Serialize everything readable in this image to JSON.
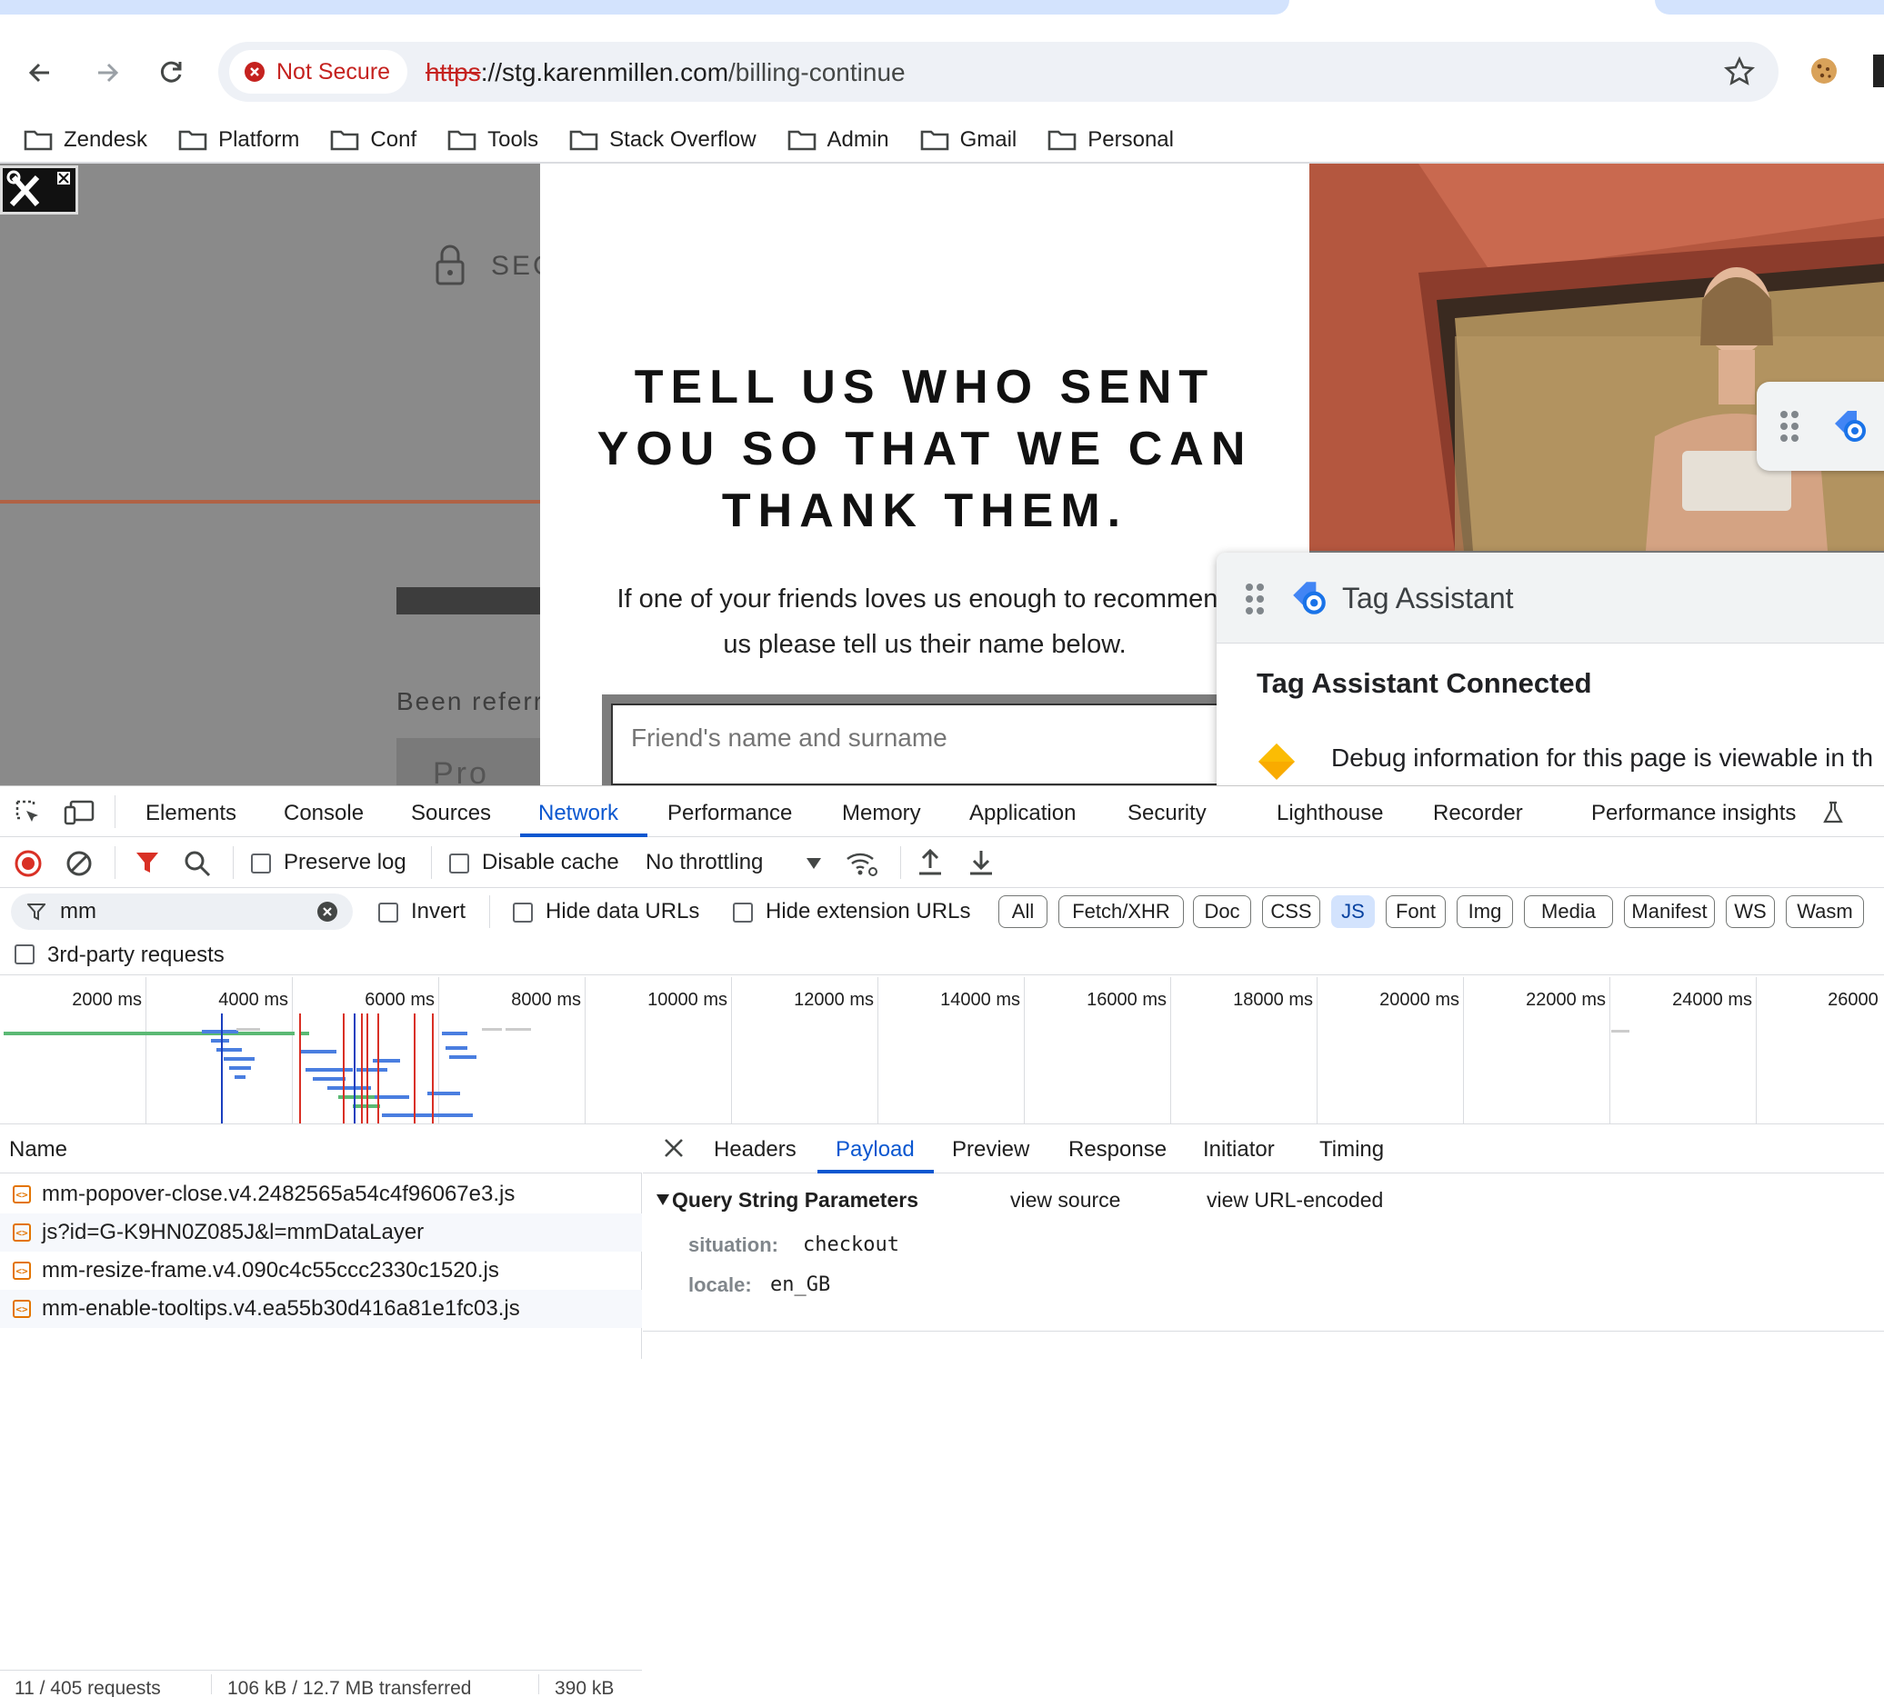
{
  "browser": {
    "security_label": "Not Secure",
    "url_scheme": "https",
    "url_separator": "://",
    "url_host": "stg.karenmillen.com",
    "url_path": "/billing-continue",
    "bookmarks": [
      "Zendesk",
      "Platform",
      "Conf",
      "Tools",
      "Stack Overflow",
      "Admin",
      "Gmail",
      "Personal"
    ]
  },
  "page": {
    "secure_text": "SEC",
    "been_referred": "Been referre",
    "promo_partial": "Pro",
    "modal": {
      "title_line1": "TELL US WHO SENT",
      "title_line2": "YOU SO THAT WE CAN",
      "title_line3": "THANK THEM.",
      "body_line1": "If one of your friends loves us enough to recommend",
      "body_line2": "us please tell us their name below.",
      "input_placeholder": "Friend's name and surname"
    }
  },
  "tag_assistant": {
    "title": "Tag Assistant",
    "status": "Tag Assistant Connected",
    "debug_text": "Debug information for this page is viewable in th"
  },
  "devtools": {
    "tabs": [
      "Elements",
      "Console",
      "Sources",
      "Network",
      "Performance",
      "Memory",
      "Application",
      "Security",
      "Lighthouse",
      "Recorder",
      "Performance insights"
    ],
    "active_tab": "Network",
    "toolbar": {
      "preserve_log": "Preserve log",
      "disable_cache": "Disable cache",
      "throttling": "No throttling"
    },
    "filter": {
      "value": "mm",
      "invert": "Invert",
      "hide_data_urls": "Hide data URLs",
      "hide_extension_urls": "Hide extension URLs",
      "types": [
        "All",
        "Fetch/XHR",
        "Doc",
        "CSS",
        "JS",
        "Font",
        "Img",
        "Media",
        "Manifest",
        "WS",
        "Wasm"
      ],
      "active_type": "JS",
      "third_party": "3rd-party requests"
    },
    "timeline_ticks": [
      "2000 ms",
      "4000 ms",
      "6000 ms",
      "8000 ms",
      "10000 ms",
      "12000 ms",
      "14000 ms",
      "16000 ms",
      "18000 ms",
      "20000 ms",
      "22000 ms",
      "24000 ms",
      "26000 m"
    ],
    "name_header": "Name",
    "requests": [
      "mm-popover-close.v4.2482565a54c4f96067e3.js",
      "js?id=G-K9HN0Z085J&l=mmDataLayer",
      "mm-resize-frame.v4.090c4c55ccc2330c1520.js",
      "mm-enable-tooltips.v4.ea55b30d416a81e1fc03.js"
    ],
    "status": {
      "requests": "11 / 405 requests",
      "transferred": "106 kB / 12.7 MB transferred",
      "resources": "390 kB"
    },
    "detail_tabs": [
      "Headers",
      "Payload",
      "Preview",
      "Response",
      "Initiator",
      "Timing"
    ],
    "active_detail_tab": "Payload",
    "payload": {
      "section_title": "Query String Parameters",
      "view_source": "view source",
      "view_url_encoded": "view URL-encoded",
      "params": [
        {
          "key": "situation:",
          "value": "checkout"
        },
        {
          "key": "locale:",
          "value": "en_GB"
        }
      ]
    }
  }
}
